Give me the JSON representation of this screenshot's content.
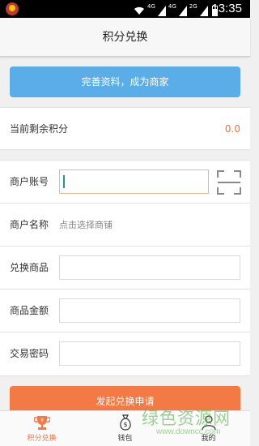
{
  "status_bar": {
    "network_1": "4G",
    "network_2": "4G",
    "network_3": "2G",
    "time": "13:35"
  },
  "header": {
    "title": "积分兑换"
  },
  "complete_profile_button": {
    "label": "完善资料，成为商家"
  },
  "points": {
    "label": "当前剩余积分",
    "value": "0.0",
    "value_color": "#f3723a"
  },
  "form": {
    "merchant_account": {
      "label": "商户账号",
      "value": ""
    },
    "merchant_name": {
      "label": "商户名称",
      "placeholder": "点击选择商铺"
    },
    "exchange_goods": {
      "label": "兑换商品",
      "value": ""
    },
    "goods_amount": {
      "label": "商品金额",
      "value": ""
    },
    "trade_password": {
      "label": "交易密码",
      "value": ""
    }
  },
  "submit_button": {
    "label": "发起兑换申请",
    "color": "#f47a45"
  },
  "tabbar": {
    "tabs": [
      {
        "label": "积分兑换",
        "icon": "trophy-icon",
        "active": true
      },
      {
        "label": "钱包",
        "icon": "money-bag-icon",
        "active": false
      },
      {
        "label": "我的",
        "icon": "user-icon",
        "active": false
      }
    ]
  },
  "watermark": {
    "text": "绿色资源网",
    "url": "www.downcc.com"
  }
}
